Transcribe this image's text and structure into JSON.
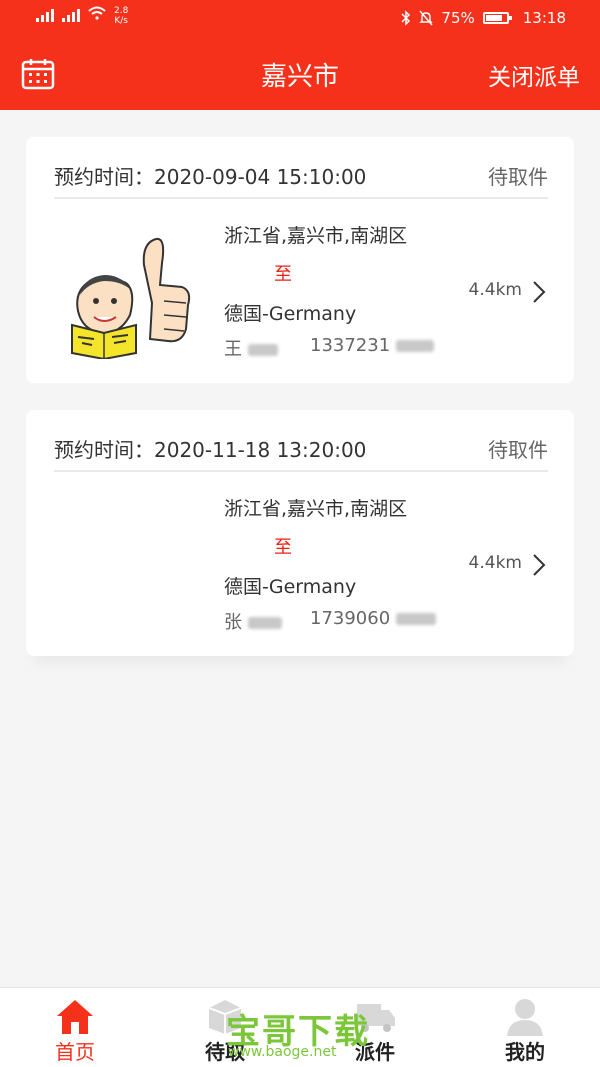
{
  "status_bar": {
    "network_speed": "2.8",
    "network_speed_unit": "K/s",
    "battery": "75%",
    "time": "13:18"
  },
  "header": {
    "title": "嘉兴市",
    "close_label": "关闭派单"
  },
  "orders": [
    {
      "appointment_label": "预约时间：2020-09-04 15:10:00",
      "status": "待取件",
      "from": "浙江省,嘉兴市,南湖区",
      "to_mark": "至",
      "to": "德国-Germany",
      "contact_name": "王",
      "contact_phone": "1337231",
      "distance": "4.4km"
    },
    {
      "appointment_label": "预约时间：2020-11-18 13:20:00",
      "status": "待取件",
      "from": "浙江省,嘉兴市,南湖区",
      "to_mark": "至",
      "to": "德国-Germany",
      "contact_name": "张",
      "contact_phone": "1739060",
      "distance": "4.4km"
    }
  ],
  "tabs": [
    {
      "label": "首页",
      "icon": "home-icon"
    },
    {
      "label": "待取",
      "icon": "package-icon"
    },
    {
      "label": "派件",
      "icon": "truck-icon"
    },
    {
      "label": "我的",
      "icon": "user-icon"
    }
  ],
  "watermark": {
    "title": "宝哥下载",
    "url": "www.baoge.net"
  },
  "colors": {
    "brand": "#f5311c",
    "to_mark": "#f01e14",
    "watermark": "#7cc63a"
  }
}
